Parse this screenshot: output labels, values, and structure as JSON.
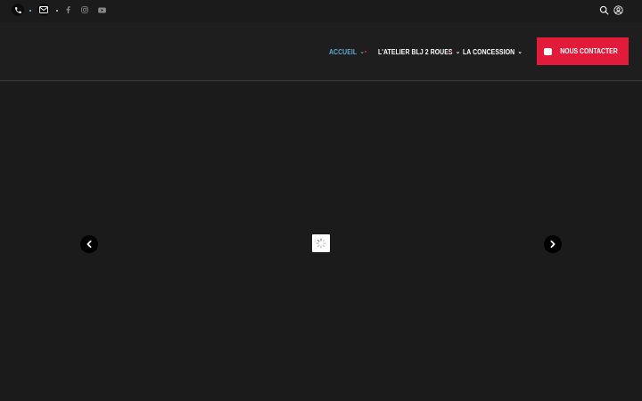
{
  "topbar": {
    "icons": [
      "phone-icon",
      "mail-icon",
      "facebook-icon",
      "instagram-icon",
      "youtube-icon",
      "search-icon",
      "user-icon"
    ]
  },
  "nav": {
    "items": [
      {
        "label": "ACCUEIL",
        "active": true
      },
      {
        "label": "L'ATELIER BLJ 2 ROUES",
        "active": false
      },
      {
        "label": "LA CONCESSION",
        "active": false
      }
    ],
    "cta_label": "NOUS CONTACTER"
  },
  "colors": {
    "background": "#1b1b1b",
    "accent_red": "#e31b3a",
    "accent_blue": "#5fa8d3"
  }
}
